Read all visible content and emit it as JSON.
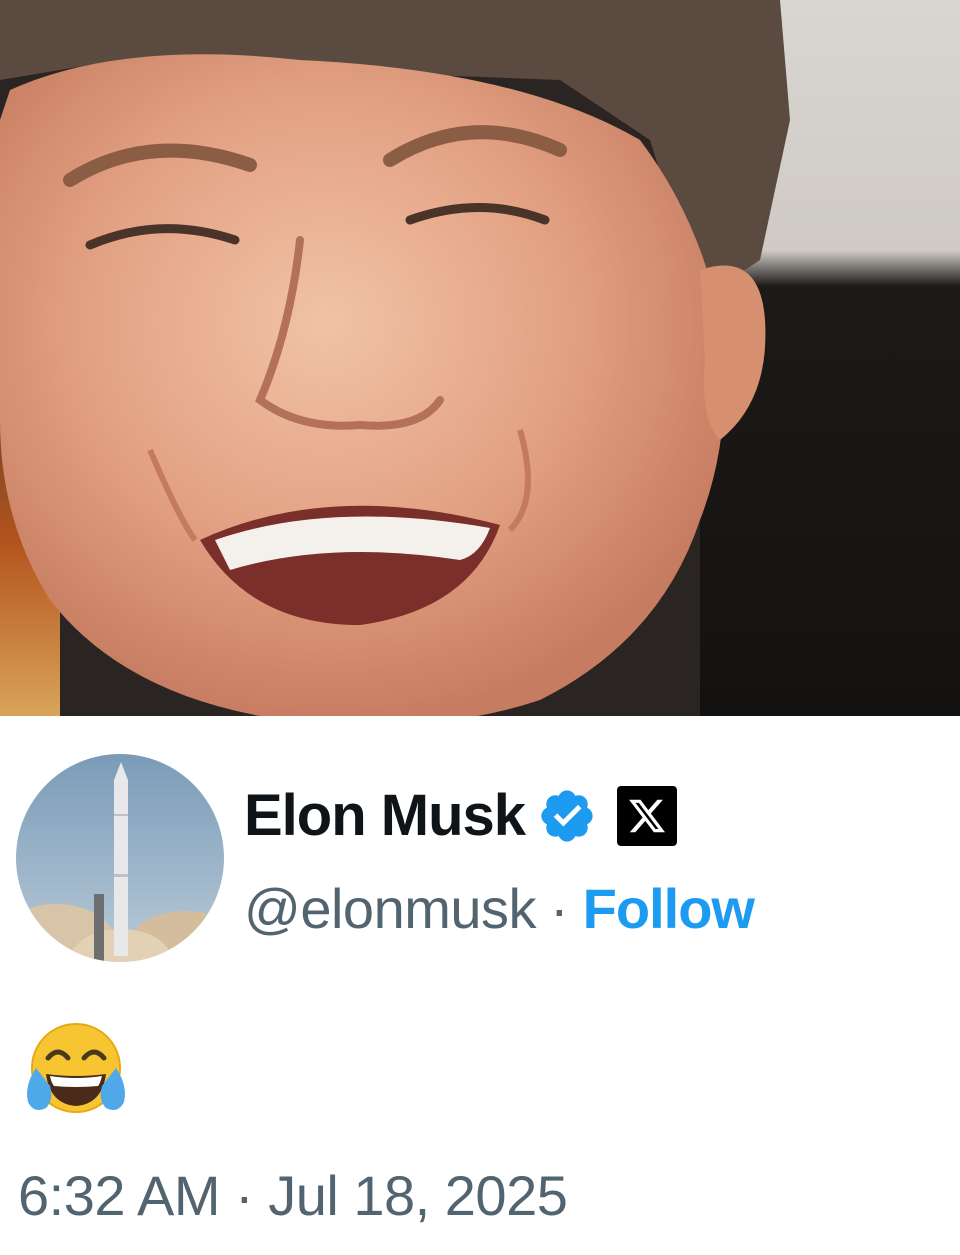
{
  "photo": {
    "subject": "man-laughing"
  },
  "tweet": {
    "author": {
      "display_name": "Elon Musk",
      "handle": "@elonmusk",
      "separator": "·",
      "follow_label": "Follow",
      "verified": true,
      "avatar_icon": "rocket-launch-avatar",
      "platform_icon": "x-logo-icon"
    },
    "body": {
      "emoji": "😂",
      "emoji_name": "face-with-tears-of-joy"
    },
    "timestamp": "6:32 AM · Jul 18, 2025"
  },
  "colors": {
    "text_primary": "#0f1419",
    "text_secondary": "#536471",
    "accent_blue": "#1d9bf0",
    "background": "#ffffff"
  }
}
